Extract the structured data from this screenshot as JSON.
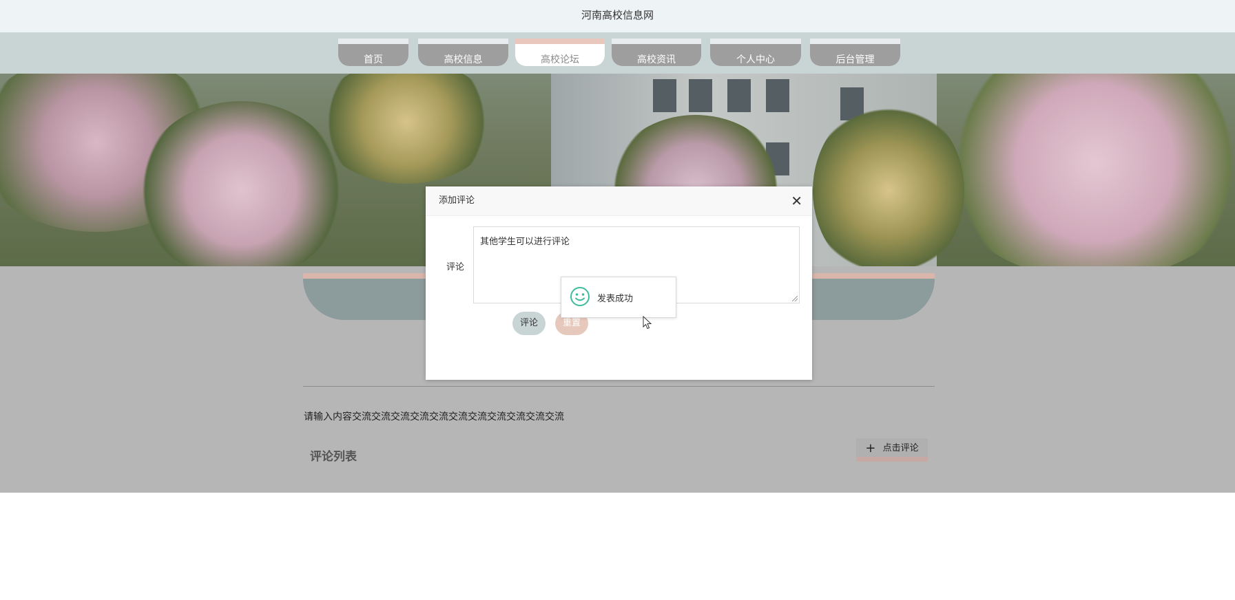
{
  "site": {
    "title": "河南高校信息网"
  },
  "nav": {
    "items": [
      {
        "label": "首页",
        "active": false
      },
      {
        "label": "高校信息",
        "active": false
      },
      {
        "label": "高校论坛",
        "active": true
      },
      {
        "label": "高校资讯",
        "active": false
      },
      {
        "label": "个人中心",
        "active": false
      },
      {
        "label": "后台管理",
        "active": false
      }
    ]
  },
  "post": {
    "content": "请输入内容交流交流交流交流交流交流交流交流交流交流交流",
    "comment_list_title": "评论列表",
    "click_comment_label": "点击评论"
  },
  "dialog": {
    "title": "添加评论",
    "field_label": "评论",
    "textarea_value": "其他学生可以进行评论",
    "submit_label": "评论",
    "reset_label": "重置"
  },
  "toast": {
    "message": "发表成功",
    "icon": "smile-icon"
  },
  "colors": {
    "nav_bg": "#c9d4d4",
    "overlay_bg": "#b6b6b6",
    "accent_pink": "#e7c8bc",
    "success_green": "#3dbd9b"
  }
}
